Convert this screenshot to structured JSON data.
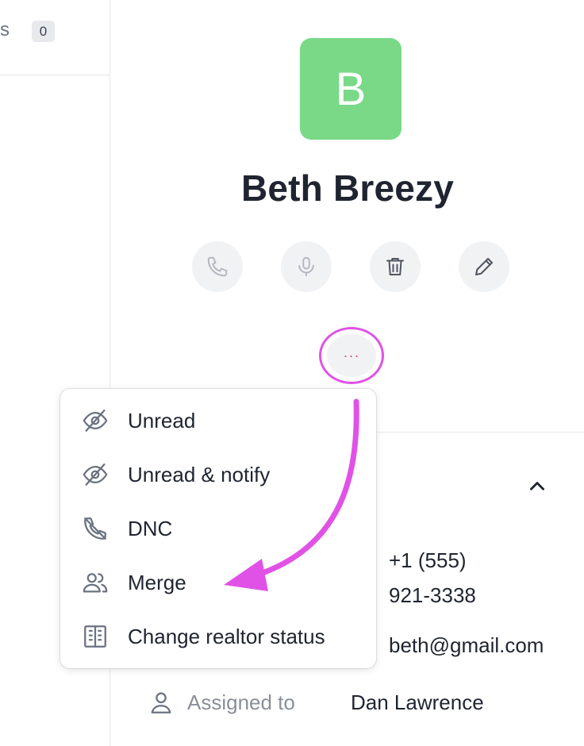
{
  "left_pane": {
    "label_fragment": "s",
    "badge_count": "0"
  },
  "contact": {
    "avatar_letter": "B",
    "avatar_color": "#79d987",
    "name": "Beth Breezy"
  },
  "actions": [
    {
      "icon": "phone-icon",
      "state": "disabled"
    },
    {
      "icon": "microphone-icon",
      "state": "disabled"
    },
    {
      "icon": "trash-icon",
      "state": "enabled"
    },
    {
      "icon": "pencil-icon",
      "state": "enabled"
    }
  ],
  "more_button": {
    "label": "···",
    "highlight_color": "#e052e6"
  },
  "menu": {
    "items": [
      {
        "label": "Unread",
        "icon": "eye-off-icon"
      },
      {
        "label": "Unread & notify",
        "icon": "eye-off-icon"
      },
      {
        "label": "DNC",
        "icon": "phone-off-icon"
      },
      {
        "label": "Merge",
        "icon": "users-icon"
      },
      {
        "label": "Change realtor status",
        "icon": "building-icon"
      }
    ]
  },
  "details": {
    "phone_line1": "+1 (555)",
    "phone_line2": "921-3338",
    "email": "beth@gmail.com",
    "assigned_label": "Assigned to",
    "assigned_value": "Dan Lawrence"
  },
  "annotation": {
    "arrow_color": "#e052e6"
  }
}
